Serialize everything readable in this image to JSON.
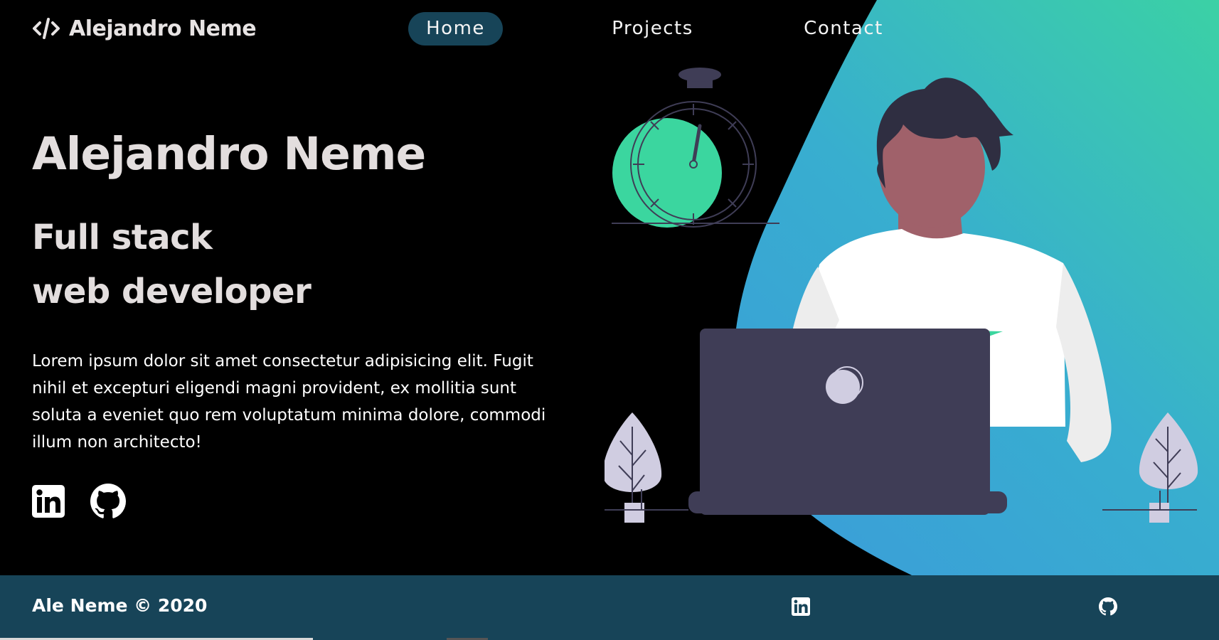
{
  "header": {
    "brand_icon": "code-icon",
    "brand_name": "Alejandro Neme",
    "nav": [
      {
        "label": "Home",
        "active": true
      },
      {
        "label": "Projects",
        "active": false
      },
      {
        "label": "Contact",
        "active": false
      }
    ]
  },
  "hero": {
    "title": "Alejandro Neme",
    "subtitle_line1": "Full stack",
    "subtitle_line2": "web developer",
    "description": "Lorem ipsum dolor sit amet consectetur adipisicing elit. Fugit nihil et excepturi eligendi magni provident, ex mollitia sunt soluta a eveniet quo rem voluptatum minima dolore, commodi illum non architecto!",
    "socials": [
      {
        "icon": "linkedin-icon"
      },
      {
        "icon": "github-icon"
      }
    ]
  },
  "footer": {
    "copyright": "Ale Neme © 2020",
    "icons": [
      "linkedin-icon",
      "github-icon"
    ]
  },
  "colors": {
    "background": "#000000",
    "nav_active": "#174458",
    "footer": "#174458",
    "text_heading": "#e3dede",
    "gradient_start": "#3bd1a5",
    "gradient_end": "#3a9fd8",
    "accent_green": "#3bd69f",
    "laptop": "#3f3d56",
    "skin": "#a0616a",
    "hair": "#2f2e41"
  }
}
